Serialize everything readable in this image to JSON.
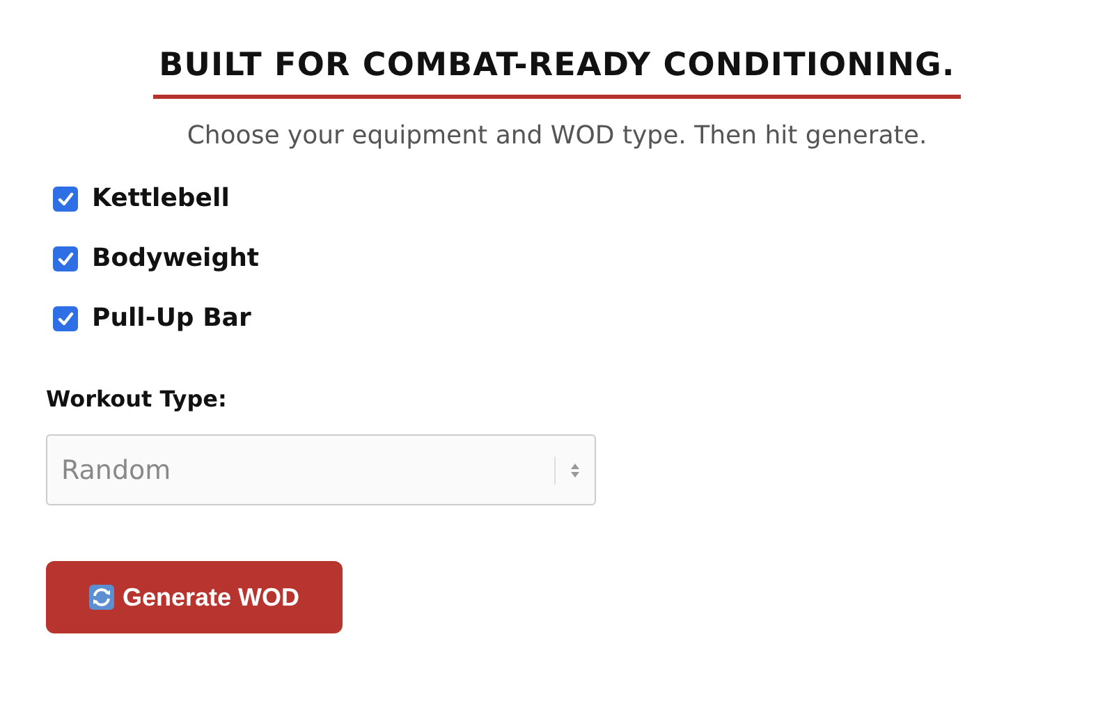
{
  "heading": "BUILT FOR COMBAT-READY CONDITIONING.",
  "subheading": "Choose your equipment and WOD type. Then hit generate.",
  "equipment": [
    {
      "label": "Kettlebell",
      "checked": true
    },
    {
      "label": "Bodyweight",
      "checked": true
    },
    {
      "label": "Pull-Up Bar",
      "checked": true
    }
  ],
  "workout_type": {
    "label": "Workout Type:",
    "value": "Random"
  },
  "generate_button": {
    "label": "Generate WOD"
  }
}
